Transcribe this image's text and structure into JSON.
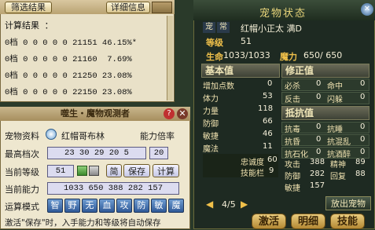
{
  "top": {
    "filter_button": "筛选结果",
    "detail_button": "详细信息",
    "result_label": "计算结果 ：",
    "rows": [
      {
        "text": "0档 0 0 0 0 0 21151 46.15%*"
      },
      {
        "text": "0档 0 0 0 0 0 21160  7.69%"
      },
      {
        "text": "0档 0 0 0 0 0 21250 23.08%"
      },
      {
        "text": "0档 0 0 0 0 0 22150 23.08%"
      }
    ]
  },
  "observer": {
    "title": "噬生・魔物观测者",
    "help_icon": "?",
    "pet_data_label": "宠物资料",
    "pet_name": "红帽哥布林",
    "growth_label": "能力倍率",
    "max_tier_label": "最高档次",
    "max_tier_value": "23 30 29 20 5",
    "growth_value": "20",
    "cur_level_label": "当前等级",
    "cur_level_value": "51",
    "simple_button": "简",
    "save_button": "保存",
    "calc_button": "计算",
    "cur_ability_label": "当前能力",
    "cur_ability_value": "1033 650 388 282 157",
    "mode_label": "运算模式",
    "modes": [
      "智",
      "野",
      "无",
      "血",
      "攻",
      "防",
      "敏",
      "魔"
    ],
    "footer": "激活\"保存\"时，入手能力和等级将自动保存"
  },
  "pet": {
    "title": "宠物状态",
    "badge1": "宠",
    "badge2": "常",
    "name": "红帽小正太 满D",
    "level_label": "等级",
    "level_value": "51",
    "hp_label": "生命",
    "hp_value": "1033/1033",
    "mp_label": "魔力",
    "mp_value": "650/ 650",
    "base_header": "基本值",
    "fix_header": "修正值",
    "resist_header": "抵抗值",
    "base": [
      {
        "label": "增加点数",
        "value": "0"
      },
      {
        "label": "体力",
        "value": "53"
      },
      {
        "label": "力量",
        "value": "118"
      },
      {
        "label": "防御",
        "value": "66"
      },
      {
        "label": "敏捷",
        "value": "46"
      },
      {
        "label": "魔法",
        "value": "11"
      }
    ],
    "fix": [
      {
        "label": "必杀",
        "value": "0",
        "label2": "命中",
        "value2": "0"
      },
      {
        "label": "反击",
        "value": "0",
        "label2": "闪躲",
        "value2": "0"
      }
    ],
    "resist": [
      {
        "label": "抗毒",
        "value": "0",
        "label2": "抗睡",
        "value2": "0"
      },
      {
        "label": "抗昏",
        "value": "0",
        "label2": "抗混乱",
        "value2": "0"
      },
      {
        "label": "抗石化",
        "value": "0",
        "label2": "抗酒醉",
        "value2": "0"
      }
    ],
    "loyalty_label": "忠诚度",
    "loyalty_value": "60",
    "skill_label": "技能栏",
    "skill_value": "9",
    "attack_label": "攻击",
    "attack_value": "388",
    "spirit_label": "精神",
    "spirit_value": "89",
    "defense_label": "防御",
    "defense_value": "282",
    "recover_label": "回复",
    "recover_value": "88",
    "agility_label": "敏捷",
    "agility_value": "157",
    "page": "4/5",
    "release_button": "放出宠物",
    "tab_flag": "激活",
    "tab_info": "明细",
    "tab_skill": "技能"
  }
}
